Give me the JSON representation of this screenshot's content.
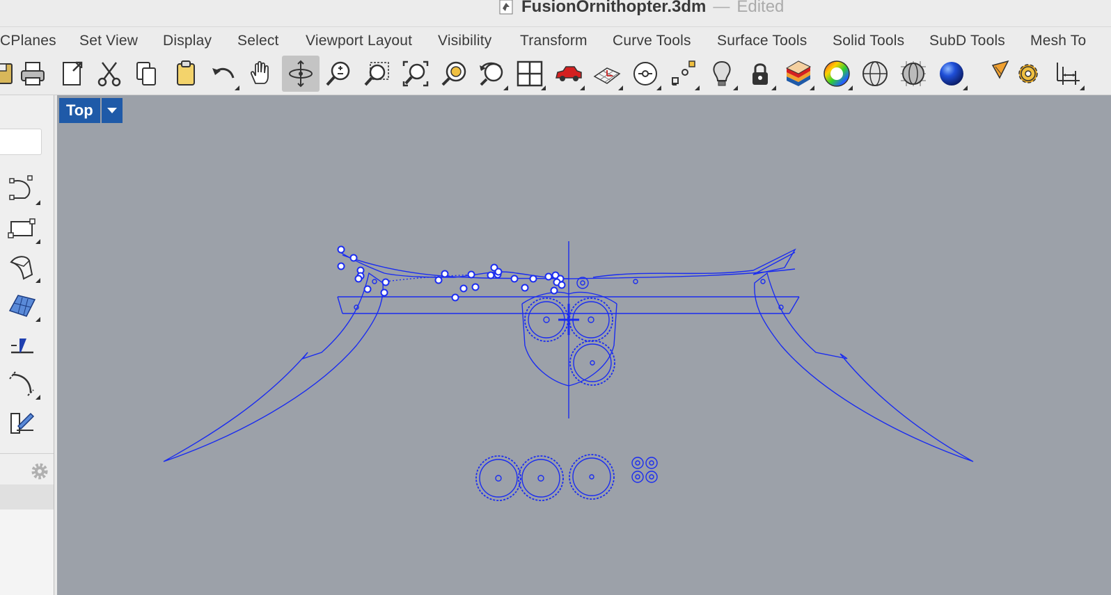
{
  "titlebar": {
    "document_name": "FusionOrnithopter.3dm",
    "separator": "—",
    "status": "Edited",
    "doc_icon": "rhino-document-icon"
  },
  "tabs": [
    {
      "label": "CPlanes"
    },
    {
      "label": "Set View"
    },
    {
      "label": "Display"
    },
    {
      "label": "Select"
    },
    {
      "label": "Viewport Layout"
    },
    {
      "label": "Visibility"
    },
    {
      "label": "Transform"
    },
    {
      "label": "Curve Tools"
    },
    {
      "label": "Surface Tools"
    },
    {
      "label": "Solid Tools"
    },
    {
      "label": "SubD Tools"
    },
    {
      "label": "Mesh To"
    }
  ],
  "toolbar": {
    "icons": [
      "save-icon",
      "print-icon",
      "export-icon",
      "cut-icon",
      "copy-icon",
      "paste-icon",
      "undo-icon",
      "pan-hand-icon",
      "rotate-view-icon",
      "zoom-in-out-icon",
      "zoom-window-icon",
      "zoom-extents-icon",
      "zoom-selected-icon",
      "undo-view-icon",
      "four-viewports-icon",
      "car-named-view-icon",
      "grid-cplane-icon",
      "point-on-icon",
      "snap-points-icon",
      "lightbulb-icon",
      "lock-icon",
      "layers-icon",
      "color-wheel-icon",
      "wireframe-sphere-icon",
      "mesh-sphere-icon",
      "rendered-sphere-icon",
      "render-icon",
      "options-gear-icon",
      "dimension-icon"
    ],
    "active_icon": "rotate-view-icon"
  },
  "left_panel": {
    "tools": [
      "curve-tool-icon",
      "rectangle-tool-icon",
      "surface-tool-icon",
      "mesh-surface-icon",
      "solid-extrude-icon",
      "fillet-arc-icon",
      "transform-tool-icon"
    ],
    "settings_icon": "gear-icon"
  },
  "viewport": {
    "name": "Top",
    "background_color": "#9ca1a9",
    "curve_color": "#1a2cf0",
    "dropdown_icon": "chevron-down-icon"
  }
}
